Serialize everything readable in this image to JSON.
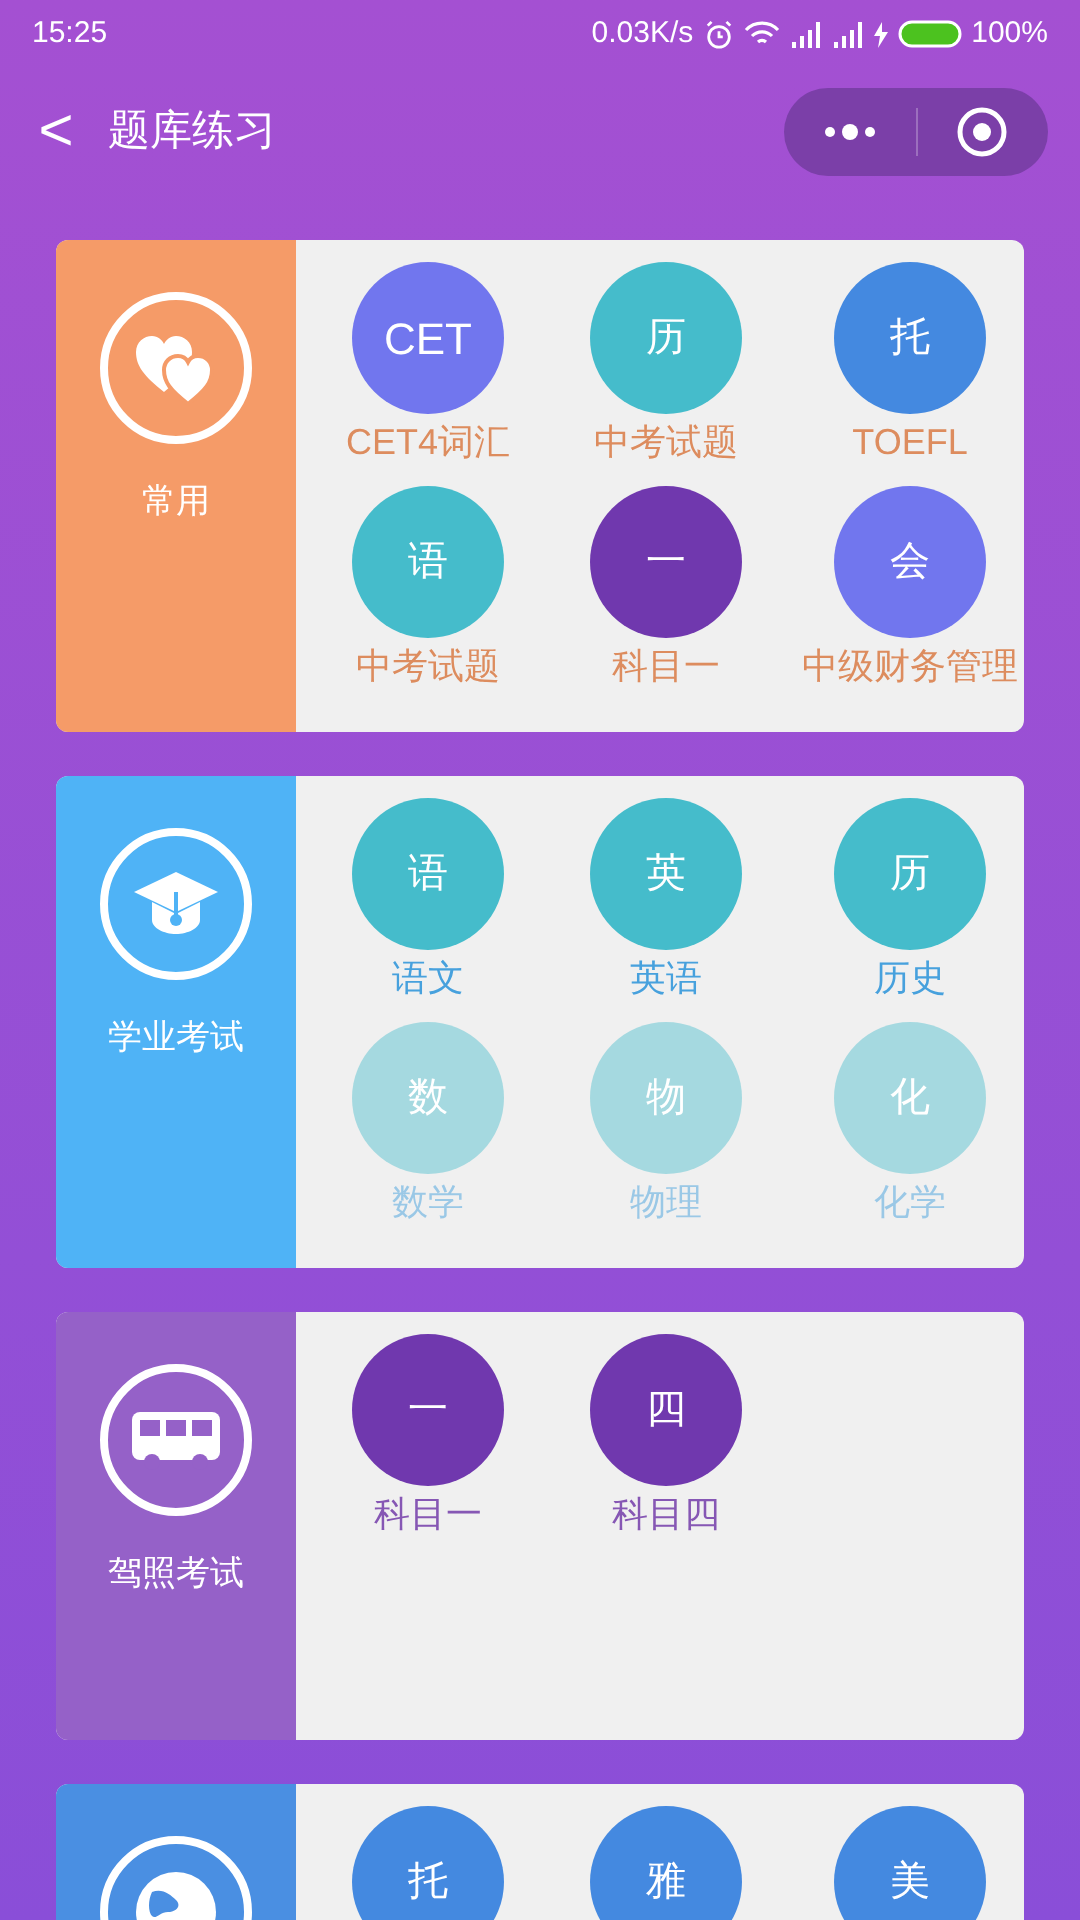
{
  "status_bar": {
    "time": "15:25",
    "speed": "0.03K/s",
    "battery": "100%"
  },
  "nav": {
    "back": "<",
    "title": "题库练习"
  },
  "categories": [
    {
      "name": "常用",
      "color": "#f59b68",
      "items": [
        {
          "glyph": "CET",
          "label": "CET4词汇",
          "color": "#7176ee",
          "disabled": false
        },
        {
          "glyph": "历",
          "label": "中考试题",
          "color": "#45bccb",
          "disabled": false
        },
        {
          "glyph": "托",
          "label": "TOEFL",
          "color": "#4489e0",
          "disabled": false
        },
        {
          "glyph": "语",
          "label": "中考试题",
          "color": "#45bccb",
          "disabled": false
        },
        {
          "glyph": "一",
          "label": "科目一",
          "color": "#7038ae",
          "disabled": false
        },
        {
          "glyph": "会",
          "label": "中级财务管理",
          "color": "#7176ee",
          "disabled": false
        }
      ]
    },
    {
      "name": "学业考试",
      "color": "#4fb3f6",
      "items": [
        {
          "glyph": "语",
          "label": "语文",
          "color": "#45bccb",
          "disabled": false
        },
        {
          "glyph": "英",
          "label": "英语",
          "color": "#45bccb",
          "disabled": false
        },
        {
          "glyph": "历",
          "label": "历史",
          "color": "#45bccb",
          "disabled": false
        },
        {
          "glyph": "数",
          "label": "数学",
          "color": "#a5d9e0",
          "disabled": true
        },
        {
          "glyph": "物",
          "label": "物理",
          "color": "#a5d9e0",
          "disabled": true
        },
        {
          "glyph": "化",
          "label": "化学",
          "color": "#a5d9e0",
          "disabled": true
        }
      ]
    },
    {
      "name": "驾照考试",
      "color": "#9561c8",
      "items": [
        {
          "glyph": "一",
          "label": "科目一",
          "color": "#7038ae",
          "disabled": false
        },
        {
          "glyph": "四",
          "label": "科目四",
          "color": "#7038ae",
          "disabled": false
        }
      ]
    },
    {
      "color": "#4a8fe2",
      "items": [
        {
          "glyph": "托",
          "color": "#4489e0"
        },
        {
          "glyph": "雅",
          "color": "#4489e0"
        },
        {
          "glyph": "美",
          "color": "#4489e0"
        }
      ]
    }
  ]
}
